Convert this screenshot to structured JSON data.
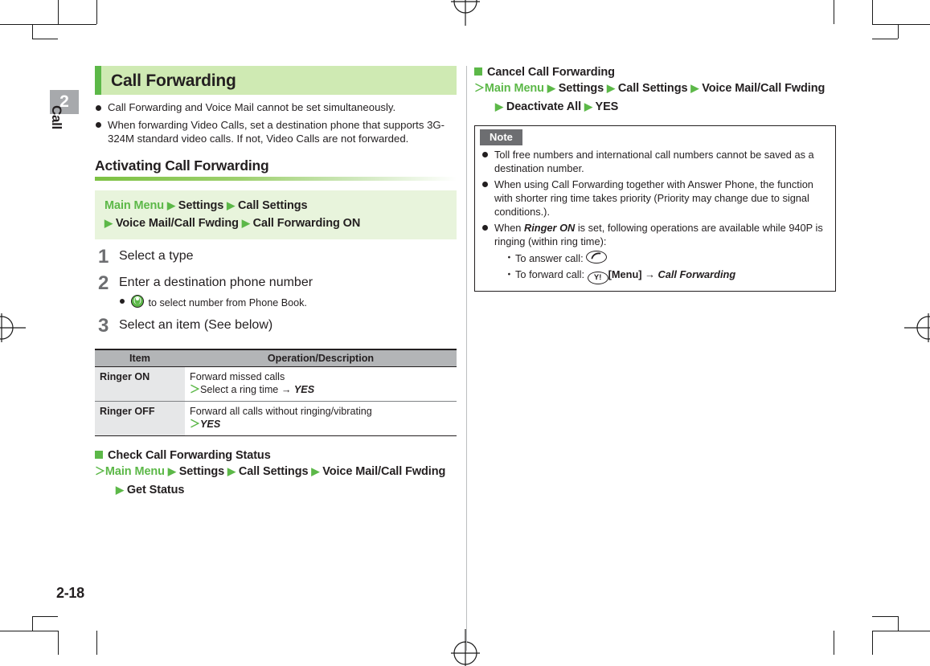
{
  "chapter_tab": {
    "number": "2",
    "label": "Call"
  },
  "page_number": "2-18",
  "left_column": {
    "title": "Call Forwarding",
    "intro_bullets": [
      "Call Forwarding and Voice Mail cannot be set simultaneously.",
      "When forwarding Video Calls, set a destination phone that supports 3G-324M standard video calls. If not, Video Calls are not forwarded."
    ],
    "subheading": "Activating Call Forwarding",
    "nav_path": {
      "start": "Main Menu",
      "line1_items": [
        "Settings",
        "Call Settings"
      ],
      "line2_items": [
        "Voice Mail/Call Fwding",
        "Call Forwarding ON"
      ]
    },
    "steps": [
      {
        "number": "1",
        "text": "Select a type",
        "sub_bullets": []
      },
      {
        "number": "2",
        "text": "Enter a destination phone number",
        "sub_bullets": [
          {
            "icon": "phonebook-key-icon",
            "text": "to select number from Phone Book."
          }
        ]
      },
      {
        "number": "3",
        "text": "Select an item (See below)",
        "sub_bullets": []
      }
    ],
    "table": {
      "headers": [
        "Item",
        "Operation/Description"
      ],
      "rows": [
        {
          "item": "Ringer ON",
          "desc_line1": "Forward missed calls",
          "desc_marker": "＞",
          "desc_line2_plain": "Select a ring time ",
          "desc_line2_arrow": "→",
          "desc_line2_em": "YES"
        },
        {
          "item": "Ringer OFF",
          "desc_line1": "Forward all calls without ringing/vibrating",
          "desc_marker": "＞",
          "desc_line2_plain": "",
          "desc_line2_arrow": "",
          "desc_line2_em": "YES"
        }
      ]
    },
    "status_section": {
      "heading": "Check Call Forwarding Status",
      "marker": "＞",
      "start": "Main Menu",
      "line1_items": [
        "Settings",
        "Call Settings",
        "Voice Mail/Call Fwding"
      ],
      "line2_items": [
        "Get Status"
      ]
    }
  },
  "right_column": {
    "cancel_section": {
      "heading": "Cancel Call Forwarding",
      "marker": "＞",
      "start": "Main Menu",
      "line1_items": [
        "Settings",
        "Call Settings",
        "Voice Mail/Call Fwding"
      ],
      "line2_items": [
        "Deactivate All",
        "YES"
      ]
    },
    "note": {
      "label": "Note",
      "bullets": [
        {
          "text": "Toll free numbers and international call numbers cannot be saved as a destination number."
        },
        {
          "text": "When using Call Forwarding together with Answer Phone, the function with shorter ring time takes priority (Priority may change due to signal conditions.)."
        }
      ],
      "ringer_bullet": {
        "lead": "When ",
        "em": "Ringer ON",
        "tail": " is set, following operations are available while 940P is ringing (within ring time):",
        "sub_items": [
          {
            "marker": "・",
            "label": "To answer call: ",
            "key_icon": "send-key-icon",
            "after": ""
          },
          {
            "marker": "・",
            "label": "To forward call: ",
            "key_icon": "yahoo-key-icon",
            "after_bold": "[Menu]",
            "arrow": "→",
            "after_em": "Call Forwarding"
          }
        ]
      }
    }
  },
  "colors": {
    "brand_green": "#5cb848",
    "title_bar_bg": "#cfeab3",
    "nav_box_bg": "#e8f4dc",
    "table_header_bg": "#b3b5b7",
    "table_item_bg": "#e6e7e8",
    "note_label_bg": "#6d6e71",
    "chapter_tab_bg": "#a7a9ac",
    "text": "#231f20"
  }
}
